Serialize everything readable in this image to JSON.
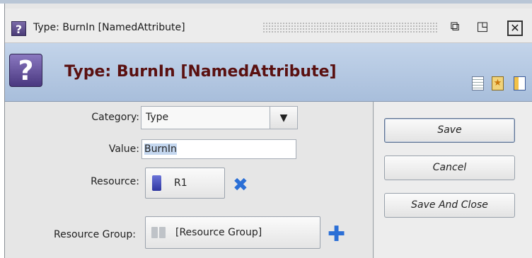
{
  "window": {
    "title": "Type: BurnIn [NamedAttribute]",
    "icon": "question-icon",
    "controls": [
      "restore-icon",
      "maximize-icon",
      "close-icon"
    ]
  },
  "header": {
    "title": "Type: BurnIn [NamedAttribute]",
    "icon": "question-icon",
    "tools": [
      "document-icon",
      "favorite-icon",
      "panel-icon"
    ]
  },
  "form": {
    "category": {
      "label": "Category:",
      "value": "Type"
    },
    "value": {
      "label": "Value:",
      "value": "BurnIn"
    },
    "resource": {
      "label": "Resource:",
      "value": "R1"
    },
    "resource_group": {
      "label": "Resource Group:",
      "value": "[Resource Group]"
    }
  },
  "actions": {
    "save": "Save",
    "cancel": "Cancel",
    "save_close": "Save And Close"
  },
  "colors": {
    "header_bg": "#b6c9e3",
    "header_title": "#5a1010",
    "accent_icon": "#2b6fd6"
  }
}
